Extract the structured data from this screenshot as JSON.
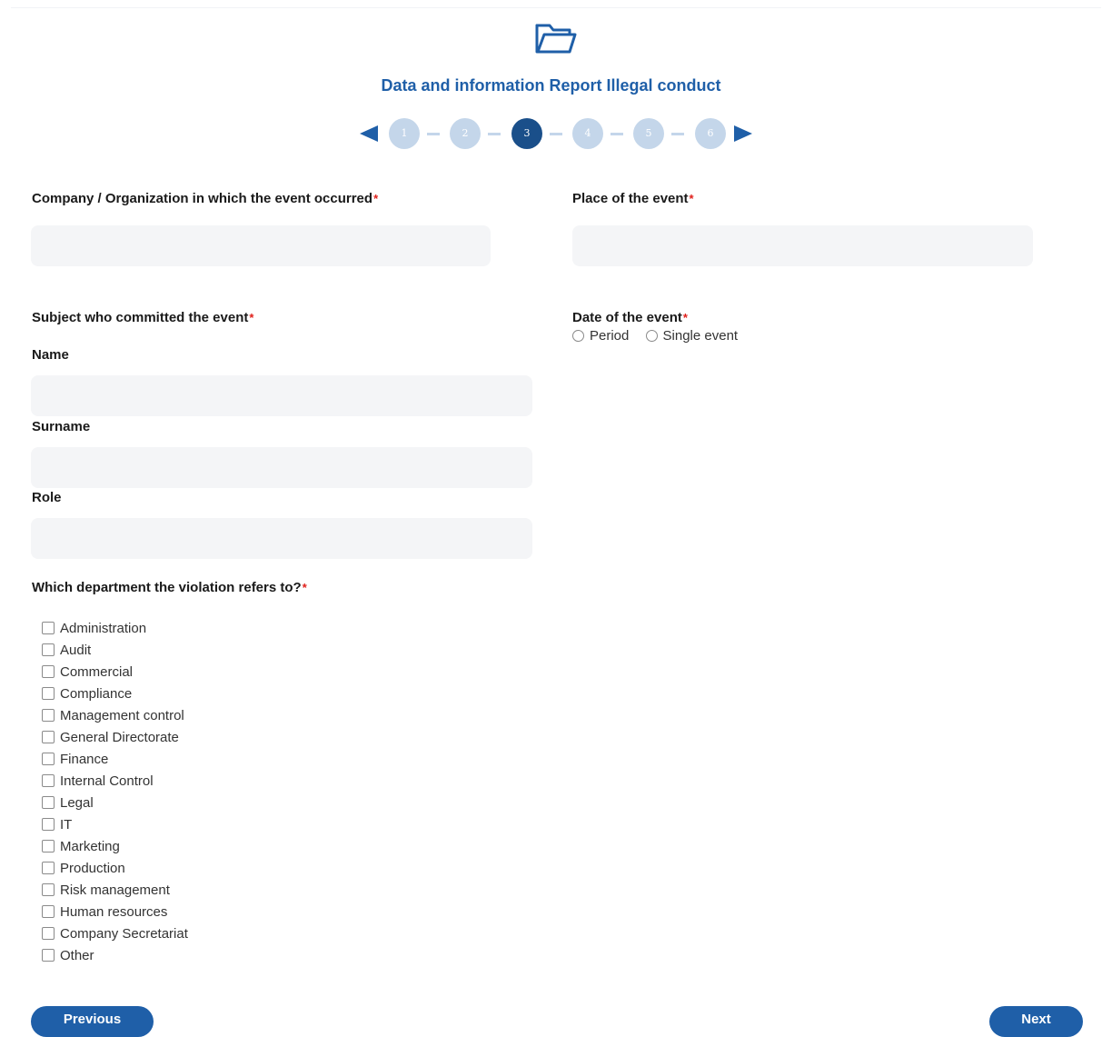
{
  "header": {
    "icon": "folder-open-icon",
    "title": "Data and information Report Illegal conduct"
  },
  "stepper": {
    "steps": [
      "1",
      "2",
      "3",
      "4",
      "5",
      "6"
    ],
    "active_step": "3",
    "prev_icon": "triangle-left-icon",
    "next_icon": "triangle-right-icon"
  },
  "fields": {
    "company_label": "Company / Organization in which the event occurred",
    "place_label": "Place of the event",
    "subject_label": "Subject who committed the event",
    "name_label": "Name",
    "surname_label": "Surname",
    "role_label": "Role",
    "date_label": "Date of the event",
    "required_mark": "*"
  },
  "date_options": [
    "Period",
    "Single event"
  ],
  "department": {
    "label": "Which department the violation refers to?",
    "options": [
      "Administration",
      "Audit",
      "Commercial",
      "Compliance",
      "Management control",
      "General Directorate",
      "Finance",
      "Internal Control",
      "Legal",
      "IT",
      "Marketing",
      "Production",
      "Risk management",
      "Human resources",
      "Company Secretariat",
      "Other"
    ]
  },
  "buttons": {
    "previous": "Previous",
    "next": "Next"
  },
  "colors": {
    "accent": "#1f5fa8",
    "step_active": "#1a4f8a",
    "step_inactive": "#c4d6ea",
    "required": "#e0201b",
    "field_bg": "#f4f5f7"
  }
}
